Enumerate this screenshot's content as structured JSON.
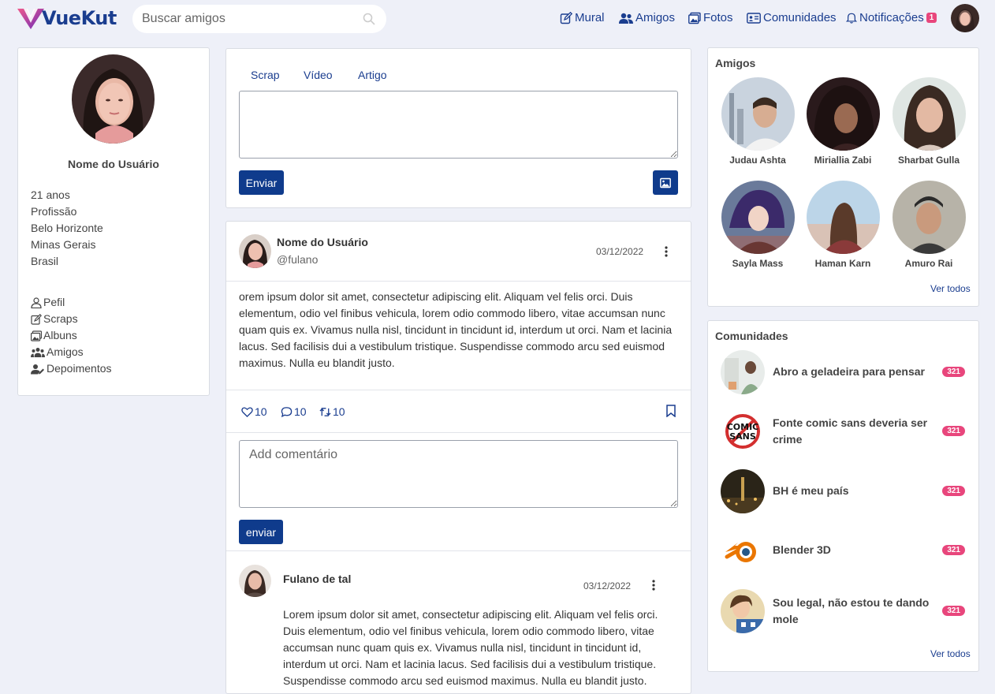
{
  "brand": {
    "name_part1": "VueKu",
    "name_part2": "t"
  },
  "search": {
    "placeholder": "Buscar amigos"
  },
  "nav": {
    "items": [
      {
        "label": "Mural",
        "icon": "edit-icon"
      },
      {
        "label": "Amigos",
        "icon": "users-icon"
      },
      {
        "label": "Fotos",
        "icon": "images-icon"
      },
      {
        "label": "Comunidades",
        "icon": "id-card-icon"
      },
      {
        "label": "Notificações",
        "icon": "bell-icon"
      }
    ],
    "notifications_count": "1"
  },
  "profile": {
    "name": "Nome do Usuário",
    "info": [
      "21 anos",
      "Profissão",
      "Belo Horizonte",
      "Minas Gerais",
      "Brasil"
    ],
    "menu": [
      {
        "label": "Pefil",
        "icon": "user-icon"
      },
      {
        "label": "Scraps",
        "icon": "edit-icon"
      },
      {
        "label": "Albuns",
        "icon": "image-icon"
      },
      {
        "label": "Amigos",
        "icon": "users-icon"
      },
      {
        "label": "Depoimentos",
        "icon": "user-pen-icon"
      }
    ]
  },
  "compose": {
    "tabs": [
      "Scrap",
      "Vídeo",
      "Artigo"
    ],
    "send_label": "Enviar"
  },
  "post": {
    "author": "Nome do Usuário",
    "handle": "@fulano",
    "date": "03/12/2022",
    "body": "orem ipsum dolor sit amet, consectetur adipiscing elit. Aliquam vel felis orci. Duis elementum, odio vel finibus vehicula, lorem odio commodo libero, vitae accumsan nunc quam quis ex. Vivamus nulla nisl, tincidunt in tincidunt id, interdum ut orci. Nam et lacinia lacus. Sed facilisis dui a vestibulum tristique. Suspendisse commodo arcu sed euismod maximus. Nulla eu blandit justo.",
    "likes": "10",
    "comments": "10",
    "reposts": "10",
    "comment_placeholder": "Add comentário",
    "comment_send_label": "enviar"
  },
  "comment": {
    "author": "Fulano de tal",
    "date": "03/12/2022",
    "body": "Lorem ipsum dolor sit amet, consectetur adipiscing elit. Aliquam vel felis orci. Duis elementum, odio vel finibus vehicula, lorem odio commodo libero, vitae accumsan nunc quam quis ex. Vivamus nulla nisl, tincidunt in tincidunt id, interdum ut orci. Nam et lacinia lacus. Sed facilisis dui a vestibulum tristique. Suspendisse commodo arcu sed euismod maximus. Nulla eu blandit justo."
  },
  "friends": {
    "title": "Amigos",
    "items": [
      "Judau Ashta",
      "Miriallia Zabi",
      "Sharbat Gulla",
      "Sayla Mass",
      "Haman Karn",
      "Amuro Rai"
    ],
    "see_all": "Ver todos"
  },
  "communities": {
    "title": "Comunidades",
    "items": [
      {
        "name": "Abro a geladeira para pensar",
        "count": "321"
      },
      {
        "name": "Fonte comic sans deveria ser crime",
        "count": "321"
      },
      {
        "name": "BH é meu país",
        "count": "321"
      },
      {
        "name": "Blender 3D",
        "count": "321"
      },
      {
        "name": "Sou legal, não estou te dando mole",
        "count": "321"
      }
    ],
    "see_all": "Ver todos"
  },
  "colors": {
    "accent": "#0f3b8c",
    "brand": "#e63e7e",
    "link": "#1a3d8f",
    "badge": "#e8467c"
  }
}
